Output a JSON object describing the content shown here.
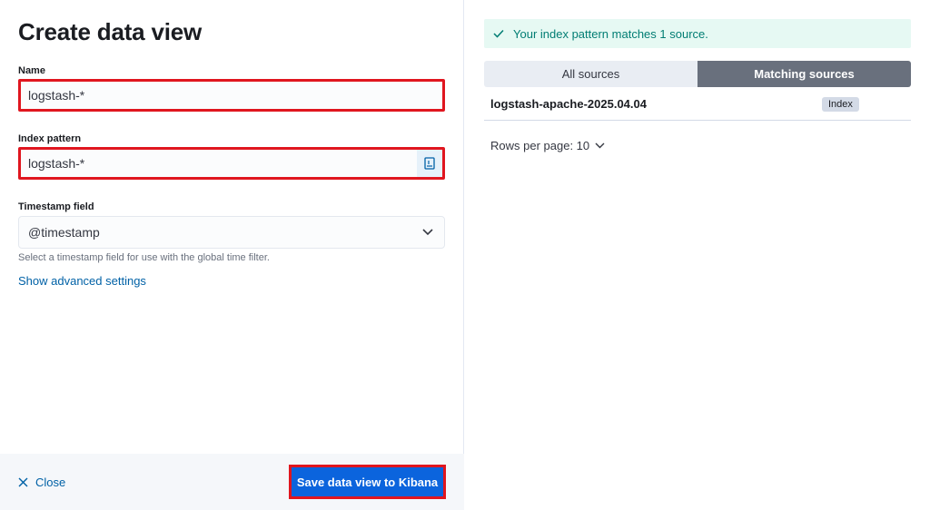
{
  "left": {
    "title": "Create data view",
    "name_label": "Name",
    "name_value": "logstash-*",
    "index_label": "Index pattern",
    "index_value": "logstash-*",
    "timestamp_label": "Timestamp field",
    "timestamp_value": "@timestamp",
    "timestamp_help": "Select a timestamp field for use with the global time filter.",
    "advanced_link": "Show advanced settings"
  },
  "footer": {
    "close_label": "Close",
    "save_label": "Save data view to Kibana"
  },
  "right": {
    "callout": "Your index pattern matches 1 source.",
    "tabs": [
      "All sources",
      "Matching sources"
    ],
    "active_tab": "Matching sources",
    "rows": [
      {
        "name": "logstash-apache-2025.04.04",
        "type": "Index"
      }
    ],
    "rows_per_page": "Rows per page: 10"
  },
  "colors": {
    "accent": "#0b64dd",
    "success": "#017d73",
    "highlight_outline": "#e0161f"
  }
}
